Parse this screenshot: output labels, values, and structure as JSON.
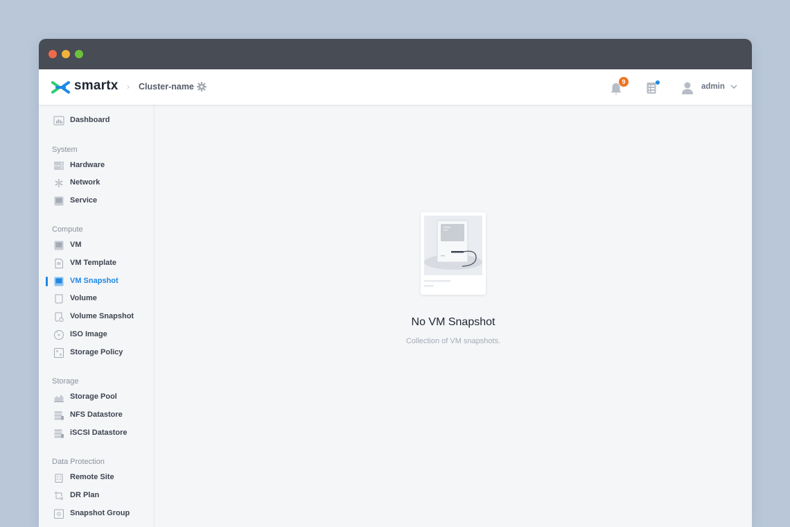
{
  "window": {
    "controls": [
      "close",
      "minimize",
      "maximize"
    ]
  },
  "header": {
    "brand": "smartx",
    "cluster_name": "Cluster-name",
    "notification_count": "9",
    "user": "admin"
  },
  "sidebar": {
    "dashboard": "Dashboard",
    "sections": {
      "system": "System",
      "compute": "Compute",
      "storage": "Storage",
      "data_protection": "Data Protection"
    },
    "items": {
      "hardware": "Hardware",
      "network": "Network",
      "service": "Service",
      "vm": "VM",
      "vm_template": "VM Template",
      "vm_snapshot": "VM Snapshot",
      "volume": "Volume",
      "volume_snapshot": "Volume Snapshot",
      "iso_image": "ISO Image",
      "storage_policy": "Storage Policy",
      "storage_pool": "Storage Pool",
      "nfs_datastore": "NFS Datastore",
      "iscsi_datastore": "iSCSI Datastore",
      "remote_site": "Remote Site",
      "dr_plan": "DR Plan",
      "snapshot_group": "Snapshot Group"
    },
    "active": "vm_snapshot"
  },
  "empty_state": {
    "title": "No VM Snapshot",
    "subtitle": "Collection of VM snapshots."
  },
  "colors": {
    "accent": "#1e88e5",
    "badge": "#f0731f",
    "titlebar": "#474c55",
    "logo_blue": "#1e88e5",
    "logo_green": "#2ecc71"
  }
}
